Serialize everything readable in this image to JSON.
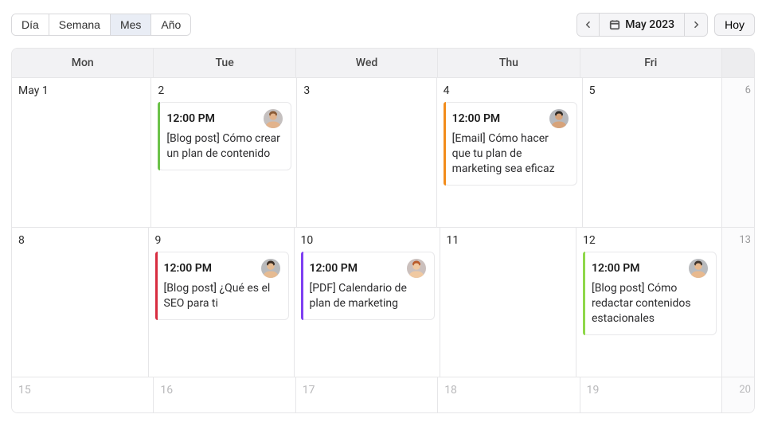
{
  "toolbar": {
    "views": {
      "day": "Día",
      "week": "Semana",
      "month": "Mes",
      "year": "Año",
      "active": "month"
    },
    "current_period": "May 2023",
    "today": "Hoy"
  },
  "calendar": {
    "day_headers": [
      "Mon",
      "Tue",
      "Wed",
      "Thu",
      "Fri"
    ],
    "weeks": [
      {
        "days": [
          {
            "n": "May 1"
          },
          {
            "n": "2",
            "event": {
              "time": "12:00 PM",
              "title": "[Blog post] Cómo crear un plan de contenido",
              "stripe": "#6cc24a",
              "avatar": "a1"
            }
          },
          {
            "n": "3"
          },
          {
            "n": "4",
            "event": {
              "time": "12:00 PM",
              "title": "[Email] Cómo hacer que tu plan de marketing sea eficaz",
              "stripe": "#f28c1b",
              "avatar": "a2"
            }
          },
          {
            "n": "5"
          }
        ],
        "extra": "6"
      },
      {
        "days": [
          {
            "n": "8"
          },
          {
            "n": "9",
            "event": {
              "time": "12:00 PM",
              "title": "[Blog post] ¿Qué es el SEO para ti",
              "stripe": "#d82c3f",
              "avatar": "a3"
            }
          },
          {
            "n": "10",
            "event": {
              "time": "12:00 PM",
              "title": "[PDF] Calendario de plan de marketing",
              "stripe": "#7e3ff2",
              "avatar": "a4"
            }
          },
          {
            "n": "11"
          },
          {
            "n": "12",
            "event": {
              "time": "12:00 PM",
              "title": "[Blog post] Cómo redactar contenidos estacionales",
              "stripe": "#8fd84a",
              "avatar": "a5"
            }
          }
        ],
        "extra": "13"
      },
      {
        "short": true,
        "faded": true,
        "days": [
          {
            "n": "15"
          },
          {
            "n": "16"
          },
          {
            "n": "17"
          },
          {
            "n": "18"
          },
          {
            "n": "19"
          }
        ],
        "extra": "20"
      }
    ]
  },
  "colors": {
    "green": "#6cc24a",
    "light_green": "#8fd84a",
    "orange": "#f28c1b",
    "red": "#d82c3f",
    "purple": "#7e3ff2"
  }
}
